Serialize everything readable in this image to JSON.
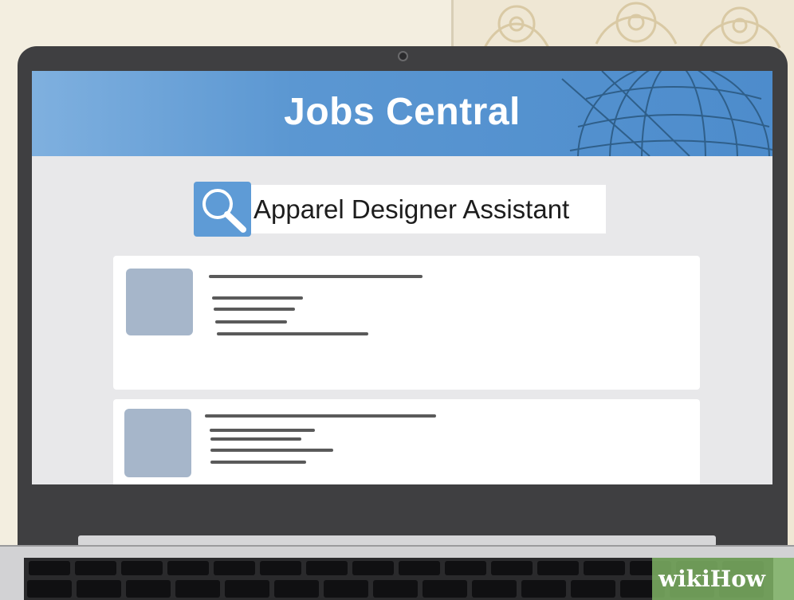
{
  "app": {
    "title": "Jobs Central"
  },
  "search": {
    "query": "Apparel Designer Assistant",
    "icon": "search-icon"
  },
  "results": [
    {
      "thumbnail": "image-placeholder"
    },
    {
      "thumbnail": "image-placeholder"
    }
  ],
  "watermark": {
    "text": "wikiHow"
  },
  "colors": {
    "header": "#5b97d2",
    "search_button": "#5e9bd6",
    "thumbnail": "#a6b6ca",
    "screen_background": "#e8e8ea",
    "laptop_bezel": "#3f3f41"
  }
}
